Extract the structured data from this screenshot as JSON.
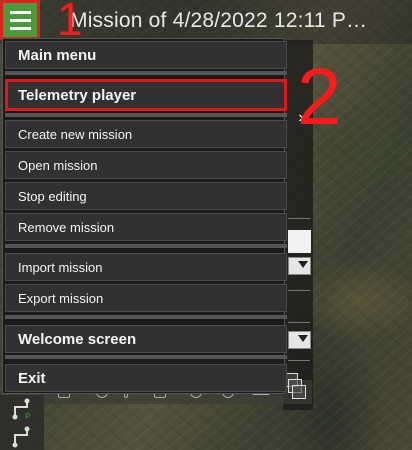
{
  "title": {
    "text": "Mission of 4/28/2022 12:11 P…"
  },
  "annotations": {
    "one": "1",
    "two": "2",
    "color": "#ff1a1a"
  },
  "hamburger": {
    "icon": "hamburger-menu-icon",
    "color": "#4c9a3c"
  },
  "menu": {
    "header_main": "Main menu",
    "telemetry_player": "Telemetry player",
    "items_group1": [
      "Create new mission",
      "Open mission",
      "Stop editing",
      "Remove mission"
    ],
    "items_group2": [
      "Import mission",
      "Export mission"
    ],
    "welcome_screen": "Welcome screen",
    "exit": "Exit"
  },
  "side_panel": {
    "expand_icon": "chevron-right-icon"
  },
  "colors": {
    "menu_bg": "#313131",
    "menu_border": "#4a4a4a",
    "highlight": "#e01818"
  }
}
